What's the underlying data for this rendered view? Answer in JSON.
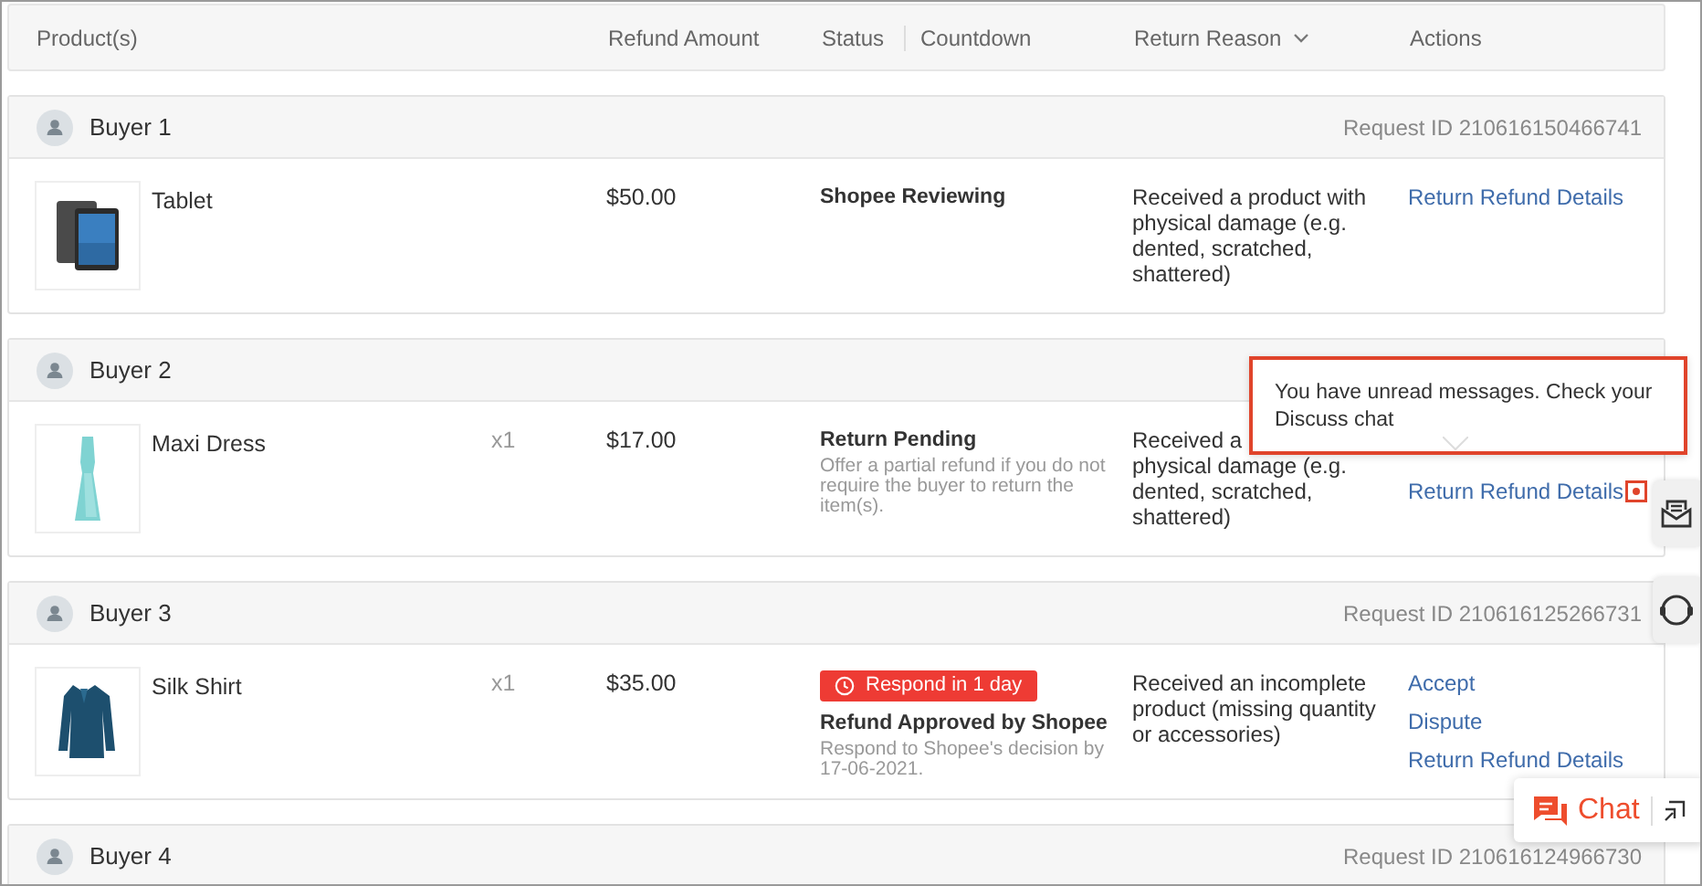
{
  "columns": [
    {
      "label": "Product(s)",
      "kind": "product"
    },
    {
      "label": "Refund Amount",
      "kind": "amount"
    },
    {
      "label": "Status",
      "kind": "status"
    },
    {
      "label": "Countdown",
      "kind": "countdown"
    },
    {
      "label": "Return Reason",
      "kind": "reason"
    },
    {
      "label": "Actions",
      "kind": "actions"
    }
  ],
  "requests": [
    {
      "buyer": "Buyer 1",
      "request_id": "Request ID 210616150466741",
      "product": {
        "name": "Tablet",
        "kind": "tablet"
      },
      "amount": "$50.00",
      "status": {
        "title": "Shopee Reviewing"
      },
      "reason": [
        "Received a product with",
        "physical damage (e.g.",
        "dented, scratched,",
        "shattered)"
      ],
      "actions": [
        "Return Refund Details"
      ]
    },
    {
      "buyer": "Buyer 2",
      "product": {
        "name": "Maxi Dress",
        "kind": "dress"
      },
      "quantity": "x1",
      "amount": "$17.00",
      "status": {
        "title": "Return Pending",
        "note": "Offer a partial refund if you do not require the buyer to return the item(s)."
      },
      "reason": [
        "Received a",
        "physical damage (e.g.",
        "dented, scratched,",
        "shattered)"
      ],
      "actions": [
        "Return Refund Details"
      ],
      "unread": true
    },
    {
      "buyer": "Buyer 3",
      "request_id": "Request ID 210616125266731",
      "product": {
        "name": "Silk Shirt",
        "kind": "shirt"
      },
      "quantity": "x1",
      "amount": "$35.00",
      "status": {
        "badge": "Respond in 1 day",
        "title": "Refund Approved by Shopee",
        "note": "Respond to Shopee's decision by 17-06-2021."
      },
      "reason": [
        "Received an incomplete",
        "product (missing quantity",
        "or accessories)"
      ],
      "actions": [
        "Accept",
        "Dispute",
        "Return Refund Details"
      ]
    },
    {
      "buyer": "Buyer 4",
      "request_id": "Request ID 210616124966730"
    }
  ],
  "tooltip": {
    "text": "You have unread messages. Check your Discuss chat"
  },
  "chat": {
    "label": "Chat"
  }
}
